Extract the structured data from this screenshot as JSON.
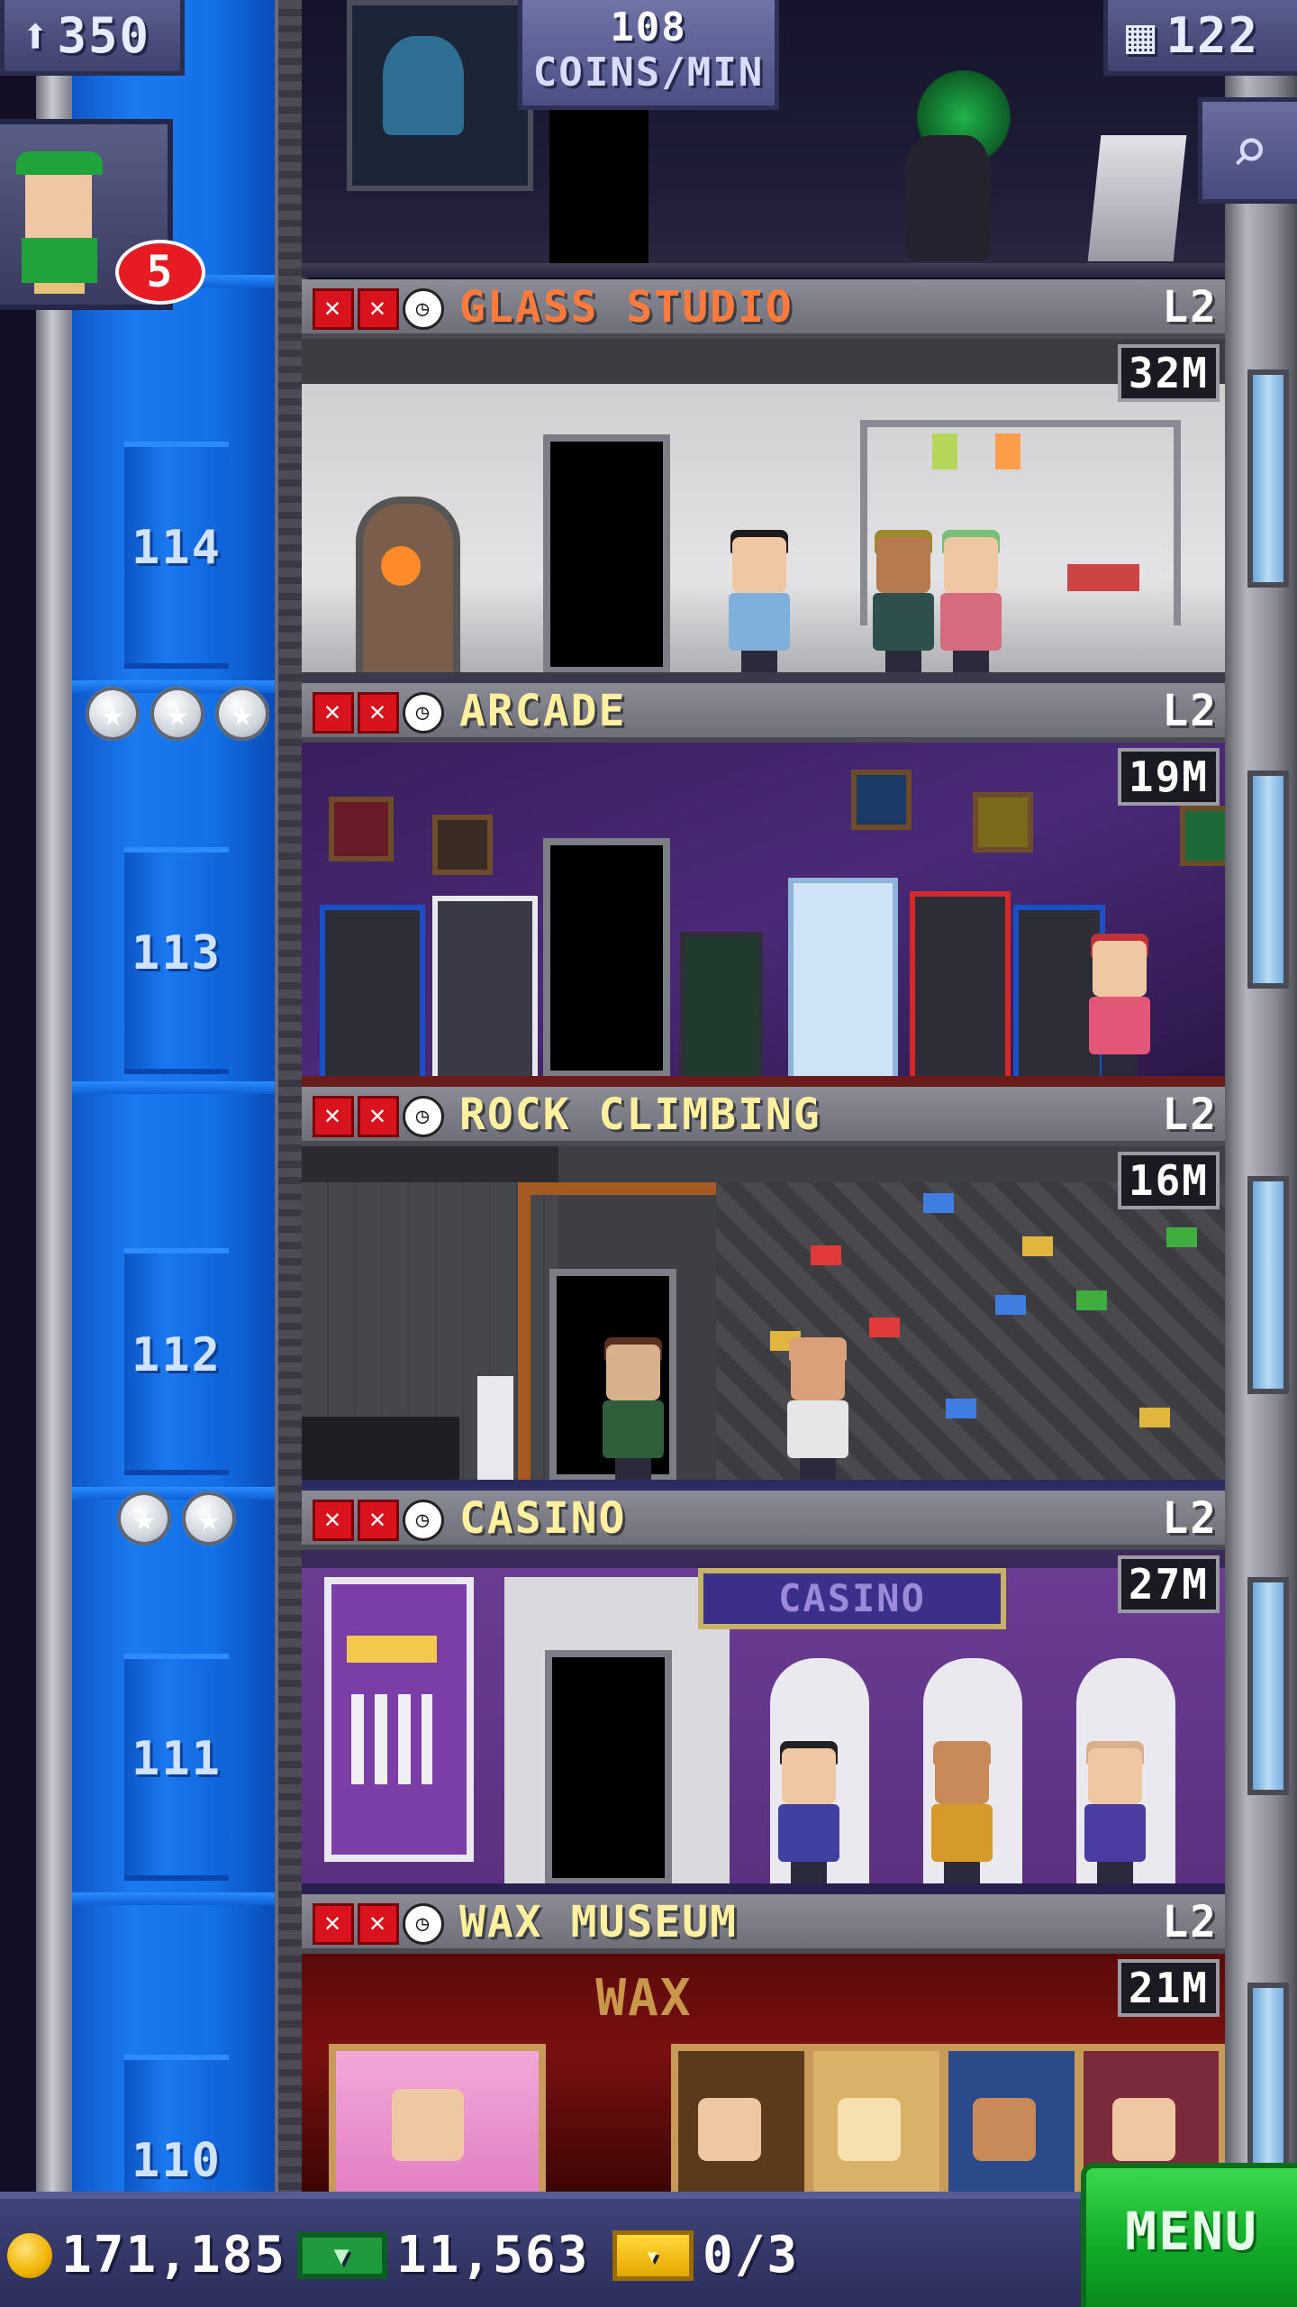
{
  "hud": {
    "population": "350",
    "coins_rate_value": "108",
    "coins_rate_label": "COINS/MIN",
    "floor_count": "122",
    "bitizen_notifications": "5"
  },
  "icons": {
    "population": "person-icon",
    "floor_count": "building-icon",
    "search": "magnifier-icon",
    "coins": "coin-icon",
    "bux": "bux-icon",
    "tickets": "ticket-icon"
  },
  "elevator": {
    "floor_numbers": [
      "114",
      "113",
      "112",
      "111",
      "110"
    ],
    "stars_row_1": 3,
    "stars_row_2": 2
  },
  "floors": [
    {
      "name": "GLASS STUDIO",
      "level": "L2",
      "time": "32M",
      "name_color": "#ff7a3d"
    },
    {
      "name": "ARCADE",
      "level": "L2",
      "time": "19M",
      "name_color": "#fff0a0"
    },
    {
      "name": "ROCK CLIMBING",
      "level": "L2",
      "time": "16M",
      "name_color": "#fff0a0"
    },
    {
      "name": "CASINO",
      "level": "L2",
      "time": "27M",
      "name_color": "#fff0a0"
    },
    {
      "name": "WAX MUSEUM",
      "level": "L2",
      "time": "21M",
      "name_color": "#fff0a0"
    }
  ],
  "signs": {
    "casino": "CASINO",
    "wax": "WAX"
  },
  "bottom_bar": {
    "coins": "171,185",
    "bux": "11,563",
    "tickets": "0/3",
    "menu_label": "MENU"
  },
  "colors": {
    "elevator_blue": "#1b7af0",
    "hud_purple": "#4c4f83",
    "menu_green": "#10a926",
    "alert_red": "#e61b23"
  }
}
